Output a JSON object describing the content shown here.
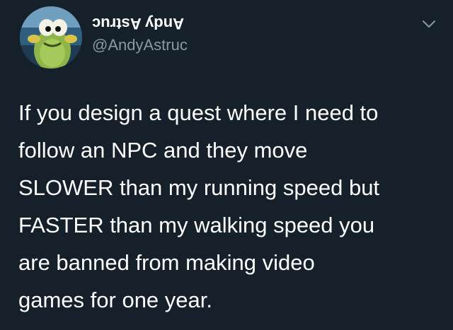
{
  "tweet": {
    "author": {
      "display_name": "Andy Astruc",
      "handle": "@AndyAstruc",
      "avatar_icon": "cartoon-fish-avatar-icon"
    },
    "menu_icon": "chevron-down-icon",
    "text_lines": [
      "If you design a quest where I need to",
      "follow an NPC and they move",
      "SLOWER than my running speed but",
      "FASTER than my walking speed you",
      "are banned from making video",
      "games for one year."
    ]
  },
  "colors": {
    "background": "#15202b",
    "text_primary": "#ffffff",
    "text_secondary": "#8899a6"
  }
}
